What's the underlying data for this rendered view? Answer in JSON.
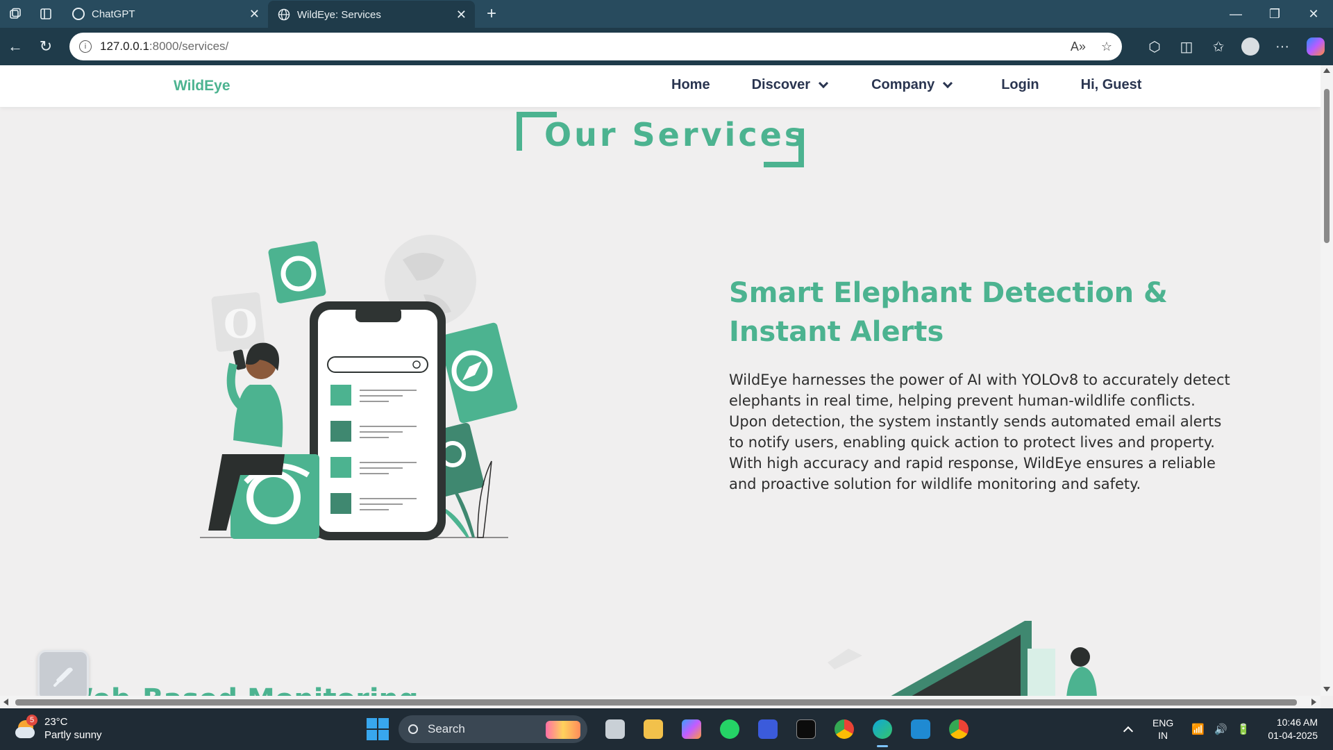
{
  "browser": {
    "tabs": [
      {
        "title": "ChatGPT",
        "active": false
      },
      {
        "title": "WildEye: Services",
        "active": true
      }
    ],
    "url_host": "127.0.0.1",
    "url_path": ":8000/services/"
  },
  "site": {
    "brand": "WildEye",
    "nav": {
      "home": "Home",
      "discover": "Discover",
      "company": "Company",
      "login": "Login",
      "greeting": "Hi, Guest"
    },
    "section_title": "Our Services",
    "service": {
      "title": "Smart Elephant Detection & Instant Alerts",
      "description": "WildEye harnesses the power of AI with YOLOv8 to accurately detect elephants in real time, helping prevent human-wildlife conflicts. Upon detection, the system instantly sends automated email alerts to notify users, enabling quick action to protect lives and property. With high accuracy and rapid response, WildEye ensures a reliable and proactive solution for wildlife monitoring and safety."
    },
    "next_service_title": "Web-Based Monitoring"
  },
  "taskbar": {
    "weather": {
      "temp": "23°C",
      "desc": "Partly sunny",
      "badge": "5"
    },
    "search_placeholder": "Search",
    "lang_line1": "ENG",
    "lang_line2": "IN",
    "time": "10:46 AM",
    "date": "01-04-2025"
  },
  "colors": {
    "accent": "#4cb390",
    "accent_dark": "#3f8870",
    "nav_text": "#2a3550",
    "chrome": "#1f3b4a"
  }
}
